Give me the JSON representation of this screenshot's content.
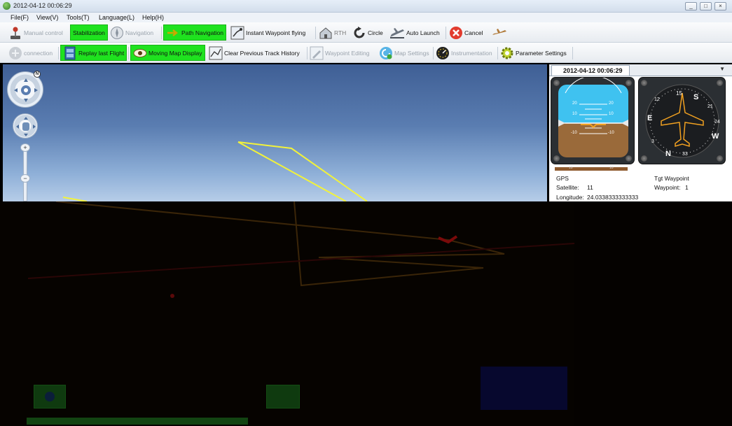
{
  "window": {
    "title": "2012-04-12 00:06:29",
    "controls": [
      "_",
      "□",
      "×"
    ]
  },
  "menu": [
    "File(F)",
    "View(V)",
    "Tools(T)",
    "Language(L)",
    "Help(H)"
  ],
  "toolbar1": {
    "manual_control": "Manual control",
    "stabilization": "Stabilization",
    "navigation": "Navigation",
    "path_navigation": "Path Navigation",
    "instant_waypoint": "Instant Waypoint flying",
    "rth": "RTH",
    "circle": "Circle",
    "auto_launch": "Auto Launch",
    "cancel": "Cancel"
  },
  "toolbar2": {
    "connection": "connection",
    "replay": "Replay last Flight",
    "moving_map": "Moving Map Display",
    "clear_track": "Clear Previous Track History",
    "waypoint_editing": "Waypoint Editing",
    "map_settings": "Map Settings",
    "instrumentation": "Instrumentation",
    "parameter_settings": "Parameter Settings"
  },
  "map": {
    "north_label": "N"
  },
  "panel": {
    "tab_title": "2012-04-12 00:06:29",
    "attitude": {
      "pitch_labels": [
        "20",
        "20",
        "10",
        "10",
        "-10",
        "-10"
      ],
      "bar_labels": [
        "10",
        "10"
      ]
    },
    "compass": {
      "labels": [
        "15",
        "S",
        "21",
        "24",
        "W",
        "33",
        "N",
        "3",
        "E",
        "12"
      ]
    },
    "gps": {
      "heading": "GPS",
      "satellite_label": "Satellite:",
      "satellite_value": "11",
      "longitude_label": "Longitude:",
      "longitude_value": "24.0338333333333"
    },
    "target": {
      "heading": "Tgt Waypoint",
      "waypoint_label": "Waypoint:",
      "waypoint_value": "1"
    }
  },
  "colors": {
    "active_green": "#1fe21f",
    "track_yellow": "#f2f23a",
    "sky_blue": "#3fc2f0",
    "ground_brown": "#9a6a3a"
  }
}
